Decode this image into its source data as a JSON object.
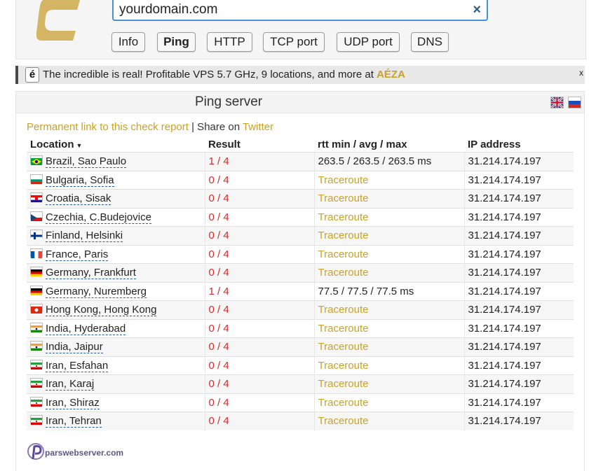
{
  "search": {
    "value": "yourdomain.com",
    "clear_icon": "×"
  },
  "tabs": [
    {
      "label": "Info",
      "active": false
    },
    {
      "label": "Ping",
      "active": true
    },
    {
      "label": "HTTP",
      "active": false
    },
    {
      "label": "TCP port",
      "active": false
    },
    {
      "label": "UDP port",
      "active": false
    },
    {
      "label": "DNS",
      "active": false
    }
  ],
  "ad": {
    "icon": "é",
    "text": "The incredible is real! Profitable VPS 5.7 GHz, 9 locations, and more at ",
    "brand": "AÉZA",
    "close": "x"
  },
  "panel": {
    "title": "Ping server"
  },
  "links": {
    "permanent": "Permanent link to this check report",
    "separator": " | Share on ",
    "twitter": "Twitter"
  },
  "table": {
    "headers": {
      "location": "Location",
      "sort_icon": "▼",
      "result": "Result",
      "rtt": "rtt min / avg / max",
      "ip": "IP address"
    },
    "rows": [
      {
        "location": "Brazil, Sao Paulo",
        "flag": "br",
        "result": "1 / 4",
        "rtt": "263.5 / 263.5 / 263.5 ms",
        "ip": "31.214.174.197"
      },
      {
        "location": "Bulgaria, Sofia",
        "flag": "bg",
        "result": "0 / 4",
        "rtt": "Traceroute",
        "ip": "31.214.174.197"
      },
      {
        "location": "Croatia, Sisak",
        "flag": "hr",
        "result": "0 / 4",
        "rtt": "Traceroute",
        "ip": "31.214.174.197"
      },
      {
        "location": "Czechia, C.Budejovice",
        "flag": "cz",
        "result": "0 / 4",
        "rtt": "Traceroute",
        "ip": "31.214.174.197"
      },
      {
        "location": "Finland, Helsinki",
        "flag": "fi",
        "result": "0 / 4",
        "rtt": "Traceroute",
        "ip": "31.214.174.197"
      },
      {
        "location": "France, Paris",
        "flag": "fr",
        "result": "0 / 4",
        "rtt": "Traceroute",
        "ip": "31.214.174.197"
      },
      {
        "location": "Germany, Frankfurt",
        "flag": "de",
        "result": "0 / 4",
        "rtt": "Traceroute",
        "ip": "31.214.174.197"
      },
      {
        "location": "Germany, Nuremberg",
        "flag": "de",
        "result": "1 / 4",
        "rtt": "77.5 / 77.5 / 77.5 ms",
        "ip": "31.214.174.197"
      },
      {
        "location": "Hong Kong, Hong Kong",
        "flag": "hk",
        "result": "0 / 4",
        "rtt": "Traceroute",
        "ip": "31.214.174.197"
      },
      {
        "location": "India, Hyderabad",
        "flag": "in",
        "result": "0 / 4",
        "rtt": "Traceroute",
        "ip": "31.214.174.197"
      },
      {
        "location": "India, Jaipur",
        "flag": "in",
        "result": "0 / 4",
        "rtt": "Traceroute",
        "ip": "31.214.174.197"
      },
      {
        "location": "Iran, Esfahan",
        "flag": "ir",
        "result": "0 / 4",
        "rtt": "Traceroute",
        "ip": "31.214.174.197"
      },
      {
        "location": "Iran, Karaj",
        "flag": "ir",
        "result": "0 / 4",
        "rtt": "Traceroute",
        "ip": "31.214.174.197"
      },
      {
        "location": "Iran, Shiraz",
        "flag": "ir",
        "result": "0 / 4",
        "rtt": "Traceroute",
        "ip": "31.214.174.197"
      },
      {
        "location": "Iran, Tehran",
        "flag": "ir",
        "result": "0 / 4",
        "rtt": "Traceroute",
        "ip": "31.214.174.197"
      }
    ]
  },
  "footer": {
    "watermark": "parswebserver.com"
  },
  "colors": {
    "accent_gold": "#c9a227",
    "result_red": "#d62b2b",
    "input_border": "#4a90d9"
  }
}
